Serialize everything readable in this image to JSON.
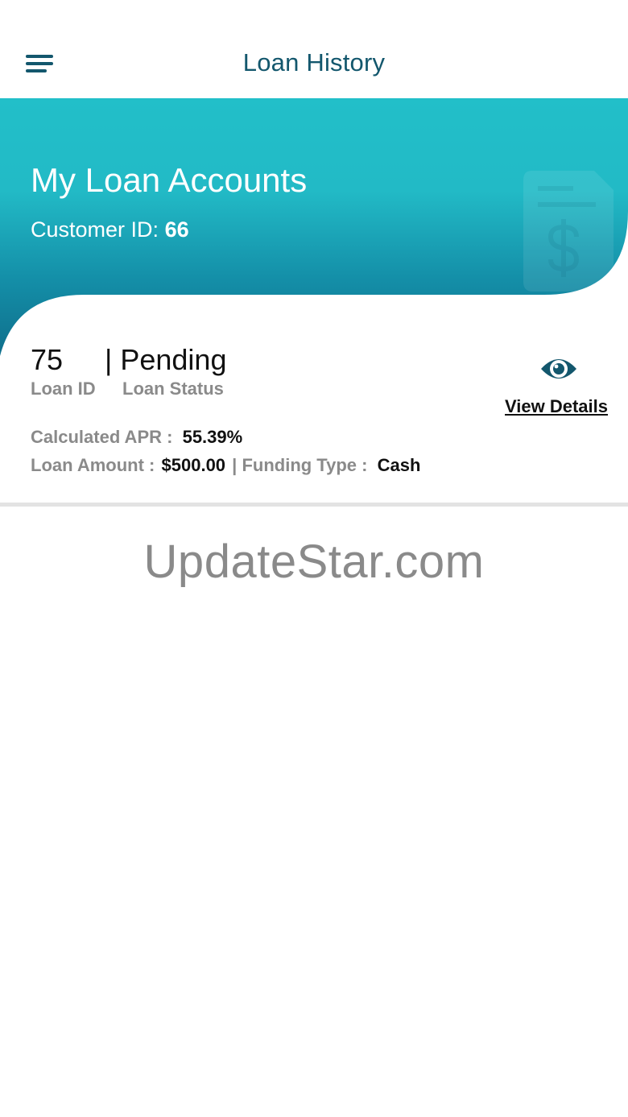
{
  "header": {
    "title": "Loan History"
  },
  "banner": {
    "title": "My Loan Accounts",
    "customer_label": "Customer ID:",
    "customer_id": "66"
  },
  "loan": {
    "id": "75",
    "status": "| Pending",
    "id_label": "Loan ID",
    "status_label": "Loan Status",
    "view_details_label": "View Details",
    "apr_label": "Calculated APR :",
    "apr_value": "55.39%",
    "amount_label": "Loan Amount :",
    "amount_value": "$500.00",
    "separator": "|",
    "funding_label": "Funding Type :",
    "funding_value": "Cash"
  },
  "watermark": "UpdateStar.com",
  "icons": {
    "menu": "hamburger-menu-icon",
    "view": "eye-icon",
    "banner_decoration": "document-dollar-icon"
  },
  "colors": {
    "primary": "#13576d",
    "banner_top": "#22bfc9",
    "banner_bottom": "#0f6f8c",
    "muted_text": "#8a8a8a"
  }
}
